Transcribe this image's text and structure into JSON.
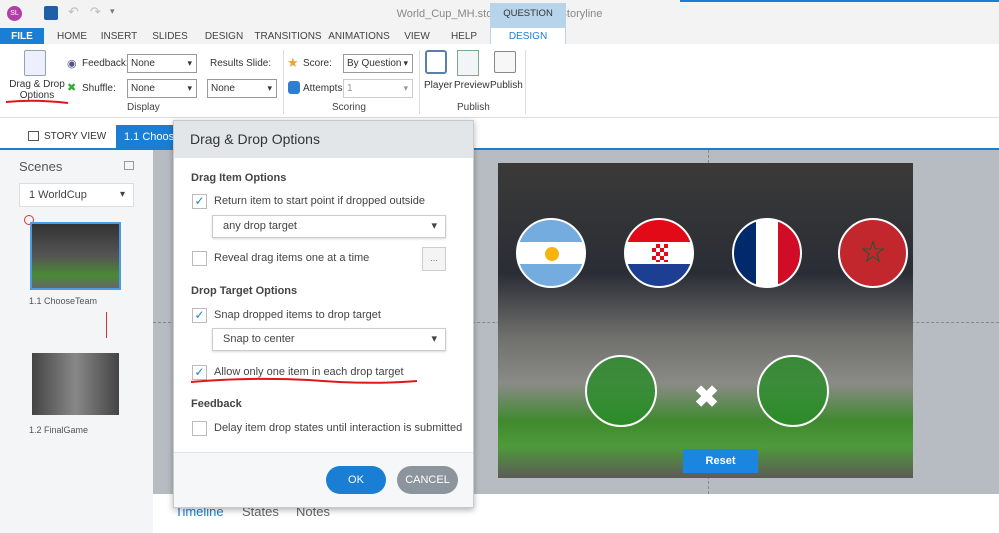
{
  "app": {
    "title": "World_Cup_MH.story - Articulate Storyline",
    "logo": "SL"
  },
  "tabs": {
    "file": "FILE",
    "items": [
      "HOME",
      "INSERT",
      "SLIDES",
      "DESIGN",
      "TRANSITIONS",
      "ANIMATIONS",
      "VIEW",
      "HELP"
    ],
    "context_group": "QUESTION TOOLS",
    "context_tab": "DESIGN"
  },
  "ribbon": {
    "drag_drop": "Drag & Drop Options",
    "feedback_label": "Feedback:",
    "feedback_value": "None",
    "shuffle_label": "Shuffle:",
    "shuffle_value": "None",
    "results_label": "Results Slide:",
    "results_value": "None",
    "display_group": "Display",
    "score_label": "Score:",
    "score_value": "By Question",
    "attempts_label": "Attempts:",
    "attempts_value": "1",
    "scoring_group": "Scoring",
    "player": "Player",
    "preview": "Preview",
    "publish": "Publish",
    "publish_group": "Publish"
  },
  "view_tabs": {
    "story_view": "STORY VIEW",
    "slide_tab": "1.1 Choos"
  },
  "scenes": {
    "title": "Scenes",
    "selected": "1 WorldCup",
    "slides": [
      "1.1 ChooseTeam",
      "1.2 FinalGame"
    ]
  },
  "slide": {
    "reset": "Reset"
  },
  "bottom_tabs": [
    "Timeline",
    "States",
    "Notes"
  ],
  "dialog": {
    "title": "Drag & Drop Options",
    "drag_section": "Drag Item Options",
    "return_label": "Return item to start point if dropped outside",
    "return_checked": true,
    "return_value": "any drop target",
    "reveal_label": "Reveal drag items one at a time",
    "reveal_checked": false,
    "reveal_button": "...",
    "drop_section": "Drop Target Options",
    "snap_label": "Snap dropped items to drop target",
    "snap_checked": true,
    "snap_value": "Snap to center",
    "allow_label": "Allow only one item in each drop target",
    "allow_checked": true,
    "feedback_section": "Feedback",
    "delay_label": "Delay item drop states until interaction is submitted",
    "delay_checked": false,
    "ok": "OK",
    "cancel": "CANCEL"
  },
  "colors": {
    "accent": "#1a7fd4",
    "annotation": "#e0161b"
  }
}
